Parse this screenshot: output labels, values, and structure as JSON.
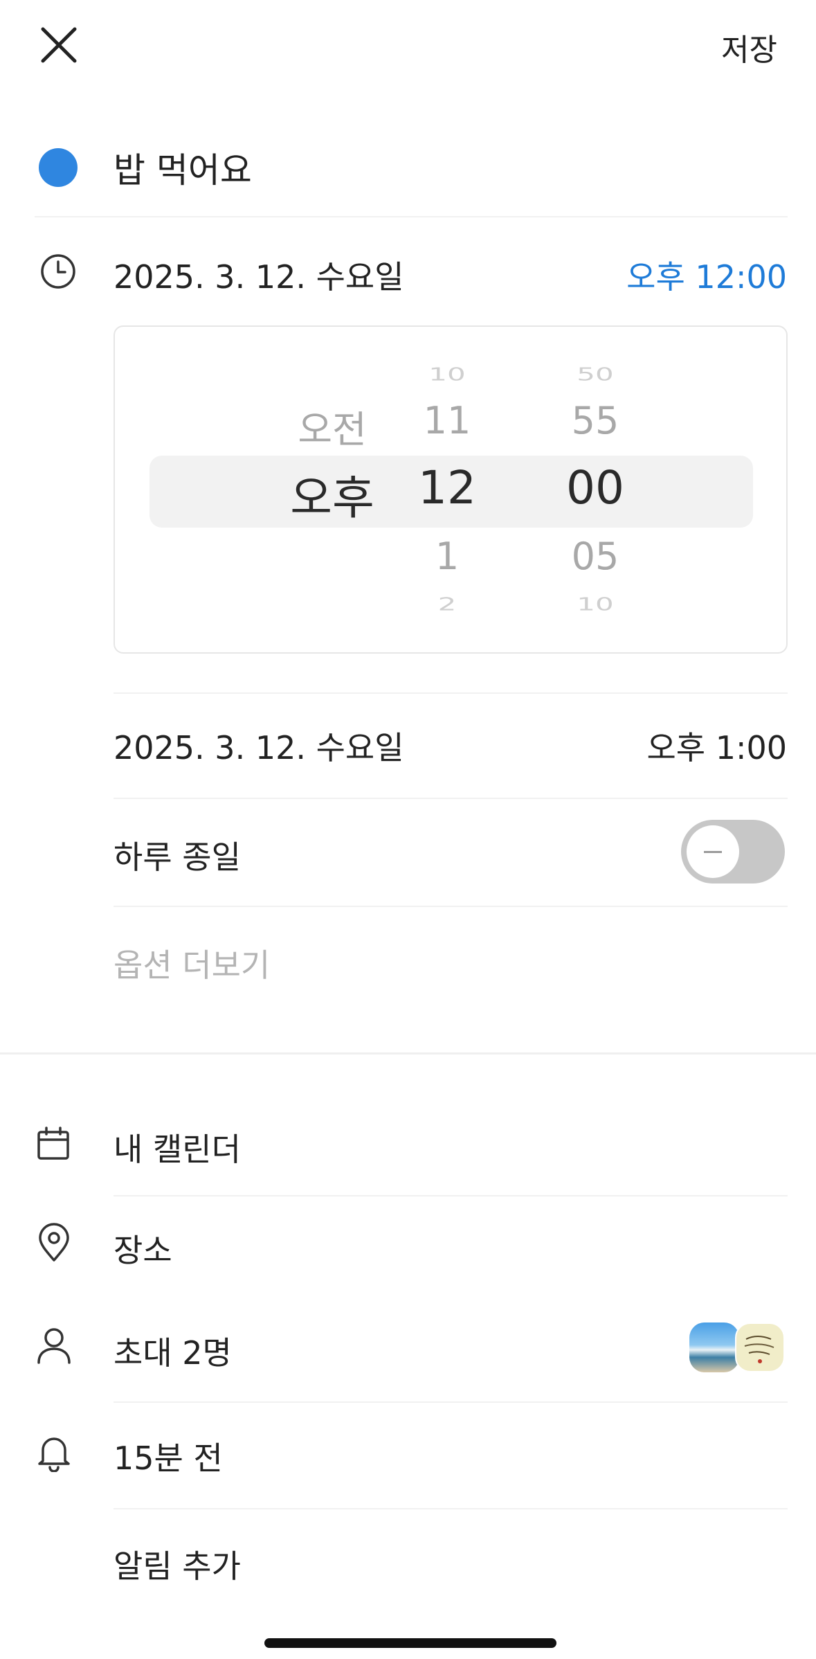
{
  "header": {
    "save_label": "저장"
  },
  "event": {
    "title": "밥 먹어요",
    "color": "#2f86e0"
  },
  "start": {
    "date": "2025. 3. 12. 수요일",
    "time": "오후 12:00",
    "time_color": "#1e7bd8"
  },
  "picker": {
    "period": {
      "prev": "오전",
      "selected": "오후"
    },
    "hour": {
      "prev2": "10",
      "prev1": "11",
      "selected": "12",
      "next1": "1",
      "next2": "2"
    },
    "minute": {
      "prev2": "50",
      "prev1": "55",
      "selected": "00",
      "next1": "05",
      "next2": "10"
    }
  },
  "end": {
    "date": "2025. 3. 12. 수요일",
    "time": "오후 1:00"
  },
  "all_day": {
    "label": "하루 종일",
    "enabled": false
  },
  "more_options": "옵션 더보기",
  "calendar": {
    "label": "내 캘린더"
  },
  "location": {
    "label": "장소"
  },
  "invitees": {
    "label": "초대 2명"
  },
  "alert": {
    "label": "15분 전"
  },
  "add_alert": {
    "label": "알림 추가"
  }
}
